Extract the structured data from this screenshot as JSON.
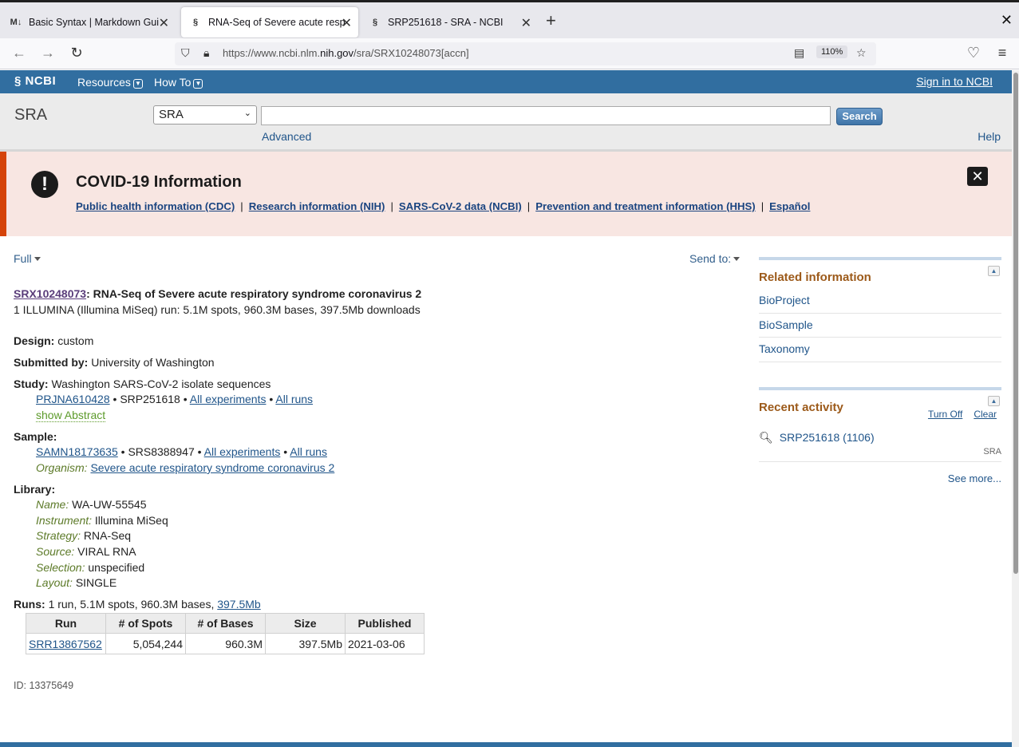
{
  "browser": {
    "tabs": [
      {
        "favicon": "M↓",
        "title": "Basic Syntax | Markdown Gui",
        "active": false
      },
      {
        "favicon": "ncbi-helix-icon",
        "title": "RNA-Seq of Severe acute resp",
        "active": true
      },
      {
        "favicon": "ncbi-helix-icon",
        "title": "SRP251618 - SRA - NCBI",
        "active": false
      }
    ],
    "url_prefix": "https://www.ncbi.nlm.",
    "url_domain": "nih.gov",
    "url_suffix": "/sra/SRX10248073[accn]",
    "zoom": "110%"
  },
  "ncbi": {
    "logo": "NCBI",
    "menu": {
      "resources": "Resources",
      "howto": "How To"
    },
    "signin": "Sign in to NCBI"
  },
  "search": {
    "db_title": "SRA",
    "db_selected": "SRA",
    "query": "",
    "button": "Search",
    "advanced": "Advanced",
    "help": "Help"
  },
  "covid": {
    "title": "COVID-19 Information",
    "links": [
      "Public health information (CDC)",
      "Research information (NIH)",
      "SARS-CoV-2 data (NCBI)",
      "Prevention and treatment information (HHS)",
      "Español"
    ],
    "separator": "|"
  },
  "record": {
    "format": "Full",
    "send_to": "Send to:",
    "accession": "SRX10248073",
    "title": ": RNA-Seq of Severe acute respiratory syndrome coronavirus 2",
    "summary": "1 ILLUMINA (Illumina MiSeq) run: 5.1M spots, 960.3M bases, 397.5Mb downloads",
    "design_label": "Design:",
    "design": "custom",
    "submitted_label": "Submitted by:",
    "submitted": "University of Washington",
    "study_label": "Study:",
    "study": "Washington SARS-CoV-2 isolate sequences",
    "study_bioproject": "PRJNA610428",
    "study_srp": "SRP251618",
    "all_experiments": "All experiments",
    "all_runs": "All runs",
    "bullet": "•",
    "show_abstract": "show Abstract",
    "sample_label": "Sample:",
    "sample_biosample": "SAMN18173635",
    "sample_srs": "SRS8388947",
    "organism_label": "Organism:",
    "organism": "Severe acute respiratory syndrome coronavirus 2",
    "library_label": "Library:",
    "library": [
      {
        "label": "Name:",
        "value": "WA-UW-55545"
      },
      {
        "label": "Instrument:",
        "value": "Illumina MiSeq"
      },
      {
        "label": "Strategy:",
        "value": "RNA-Seq"
      },
      {
        "label": "Source:",
        "value": "VIRAL RNA"
      },
      {
        "label": "Selection:",
        "value": "unspecified"
      },
      {
        "label": "Layout:",
        "value": "SINGLE"
      }
    ],
    "runs_label": "Runs:",
    "runs_summary": "1 run, 5.1M spots, 960.3M bases,",
    "runs_size_link": "397.5Mb",
    "run_table": {
      "headers": [
        "Run",
        "# of Spots",
        "# of Bases",
        "Size",
        "Published"
      ],
      "rows": [
        [
          "SRR13867562",
          "5,054,244",
          "960.3M",
          "397.5Mb",
          "2021-03-06"
        ]
      ]
    },
    "id_line": "ID: 13375649"
  },
  "sidebar": {
    "related_title": "Related information",
    "related_items": [
      "BioProject",
      "BioSample",
      "Taxonomy"
    ],
    "recent_title": "Recent activity",
    "turn_off": "Turn Off",
    "clear": "Clear",
    "recent_item": "SRP251618 (1106)",
    "recent_db": "SRA",
    "see_more": "See more..."
  }
}
